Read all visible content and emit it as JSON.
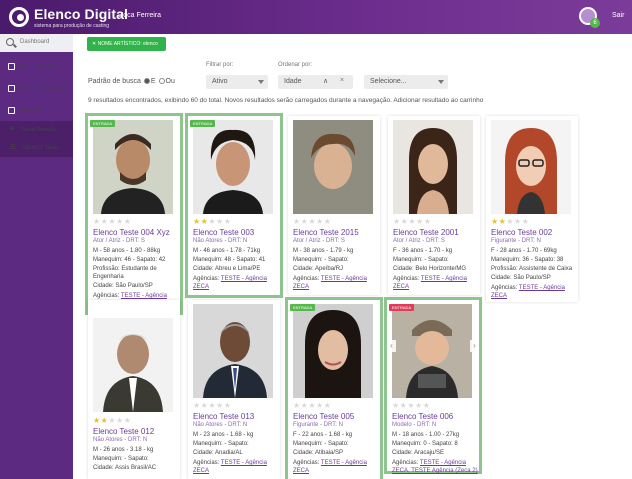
{
  "header": {
    "app_title": "Elenco Digital",
    "app_subtitle": "sistema para produção de casting",
    "user_name": "Zoca Ferreira",
    "logout_label": "Sair",
    "notification_count": "6"
  },
  "sidebar": {
    "search_placeholder": "Dashboard",
    "items": [
      {
        "label": "Acesso Bookers"
      },
      {
        "label": "Lista de Produtores"
      },
      {
        "label": "Seleções"
      },
      {
        "label": "Nova Seleção"
      },
      {
        "label": "SELECT Teste"
      }
    ]
  },
  "filter_chip": {
    "label": "NOME ARTÍSTICO: elenco"
  },
  "search": {
    "mode_label": "Padrão de busca",
    "mode_and": "E",
    "mode_or": "Ou",
    "filter_label": "Filtrar por:",
    "filter_value": "Ativo",
    "order_label": "Ordenar por:",
    "order_value": "Idade",
    "order_direction": "∧",
    "order_clear": "×",
    "select_placeholder": "Selecione...",
    "results_info": "9 resultados encontrados, exibindo 60 do total. Novos resultados serão carregados durante a navegação. Adicionar resultado ao carrinho"
  },
  "cards": [
    {
      "badge": "ENTRADA",
      "badge_color": "#55b84c",
      "stars": 0,
      "name": "Elenco Teste 004 Xyz",
      "category": "Ator / Atriz - DRT: S",
      "line1": "M - 58 anos - 1.80 - 88kg",
      "line2": "Manequim: 46 - Sapato: 42",
      "line3": "Profissão: Estudante de",
      "line4": "Engenharia",
      "line5": "Cidade: São Paulo/SP",
      "agency_label": "Agências:",
      "agency": "TESTE - Agência ZECA"
    },
    {
      "badge": "ENTRADA",
      "badge_color": "#55b84c",
      "stars": 2,
      "name": "Elenco Teste 003",
      "category": "Não Atores - DRT: N",
      "line1": "M - 46 anos - 1.78 - 71kg",
      "line2": "Manequim: 48 - Sapato: 41",
      "line3": "Cidade: Abreu e Lima/PE",
      "agency_label": "Agências:",
      "agency": "TESTE - Agência ZECA"
    },
    {
      "badge": "",
      "stars": 0,
      "name": "Elenco Teste 2015",
      "category": "Ator / Atriz - DRT: S",
      "line1": "M - 38 anos - 1.79 - kg",
      "line2": "Manequim: - Sapato:",
      "line3": "Cidade: Apeíba/RJ",
      "agency_label": "Agências:",
      "agency": "TESTE - Agência ZECA"
    },
    {
      "badge": "",
      "stars": 0,
      "name": "Elenco Teste 2001",
      "category": "Ator / Atriz - DRT: S",
      "line1": "F - 36 anos - 1.70 - kg",
      "line2": "Manequim: - Sapato:",
      "line3": "Cidade: Belo Horizonte/MG",
      "agency_label": "Agências:",
      "agency": "TESTE - Agência ZECA"
    },
    {
      "badge": "",
      "stars": 2,
      "name": "Elenco Teste 002",
      "category": "Figurante - DRT: N",
      "line1": "F - 28 anos - 1.70 - 69kg",
      "line2": "Manequim: 36 - Sapato: 38",
      "line3": "Profissão: Assistente de Caixa",
      "line4": "Cidade: São Paulo/SP",
      "agency_label": "Agências:",
      "agency": "TESTE - Agência ZECA"
    },
    {
      "badge": "",
      "stars": 2,
      "name": "Elenco Teste 012",
      "category": "Não Atores - DRT: N",
      "line1": "M - 26 anos - 3.18 - kg",
      "line2": "Manequim: - Sapato:",
      "line3": "Cidade: Assis Brasil/AC",
      "agency_label": "",
      "agency": ""
    },
    {
      "badge": "",
      "stars": 0,
      "name": "Elenco Teste 013",
      "category": "Não Atores - DRT: N",
      "line1": "M - 23 anos - 1.68 - kg",
      "line2": "Manequim: - Sapato:",
      "line3": "Cidade: Anadia/AL",
      "agency_label": "Agências:",
      "agency": "TESTE - Agência ZECA"
    },
    {
      "badge": "ENTRADA",
      "badge_color": "#55b84c",
      "stars": 0,
      "name": "Elenco Teste 005",
      "category": "Figurante - DRT: N",
      "line1": "F - 22 anos - 1.68 - kg",
      "line2": "Manequim: - Sapato:",
      "line3": "Cidade: Atibaia/SP",
      "agency_label": "Agências:",
      "agency": "TESTE - Agência ZECA"
    },
    {
      "badge": "ENTRADA",
      "badge_color": "#e03d5c",
      "stars": 0,
      "name": "Elenco Teste 006",
      "category": "Modelo - DRT: N",
      "line1": "M - 18 anos - 1.00 - 27kg",
      "line2": "Manequim: 0 - Sapato: 8",
      "line3": "Cidade: Aracaju/SE",
      "agency_label": "Agências:",
      "agency": "TESTE - Agência ZECA, TESTE Agência (Zeca 2)"
    }
  ]
}
